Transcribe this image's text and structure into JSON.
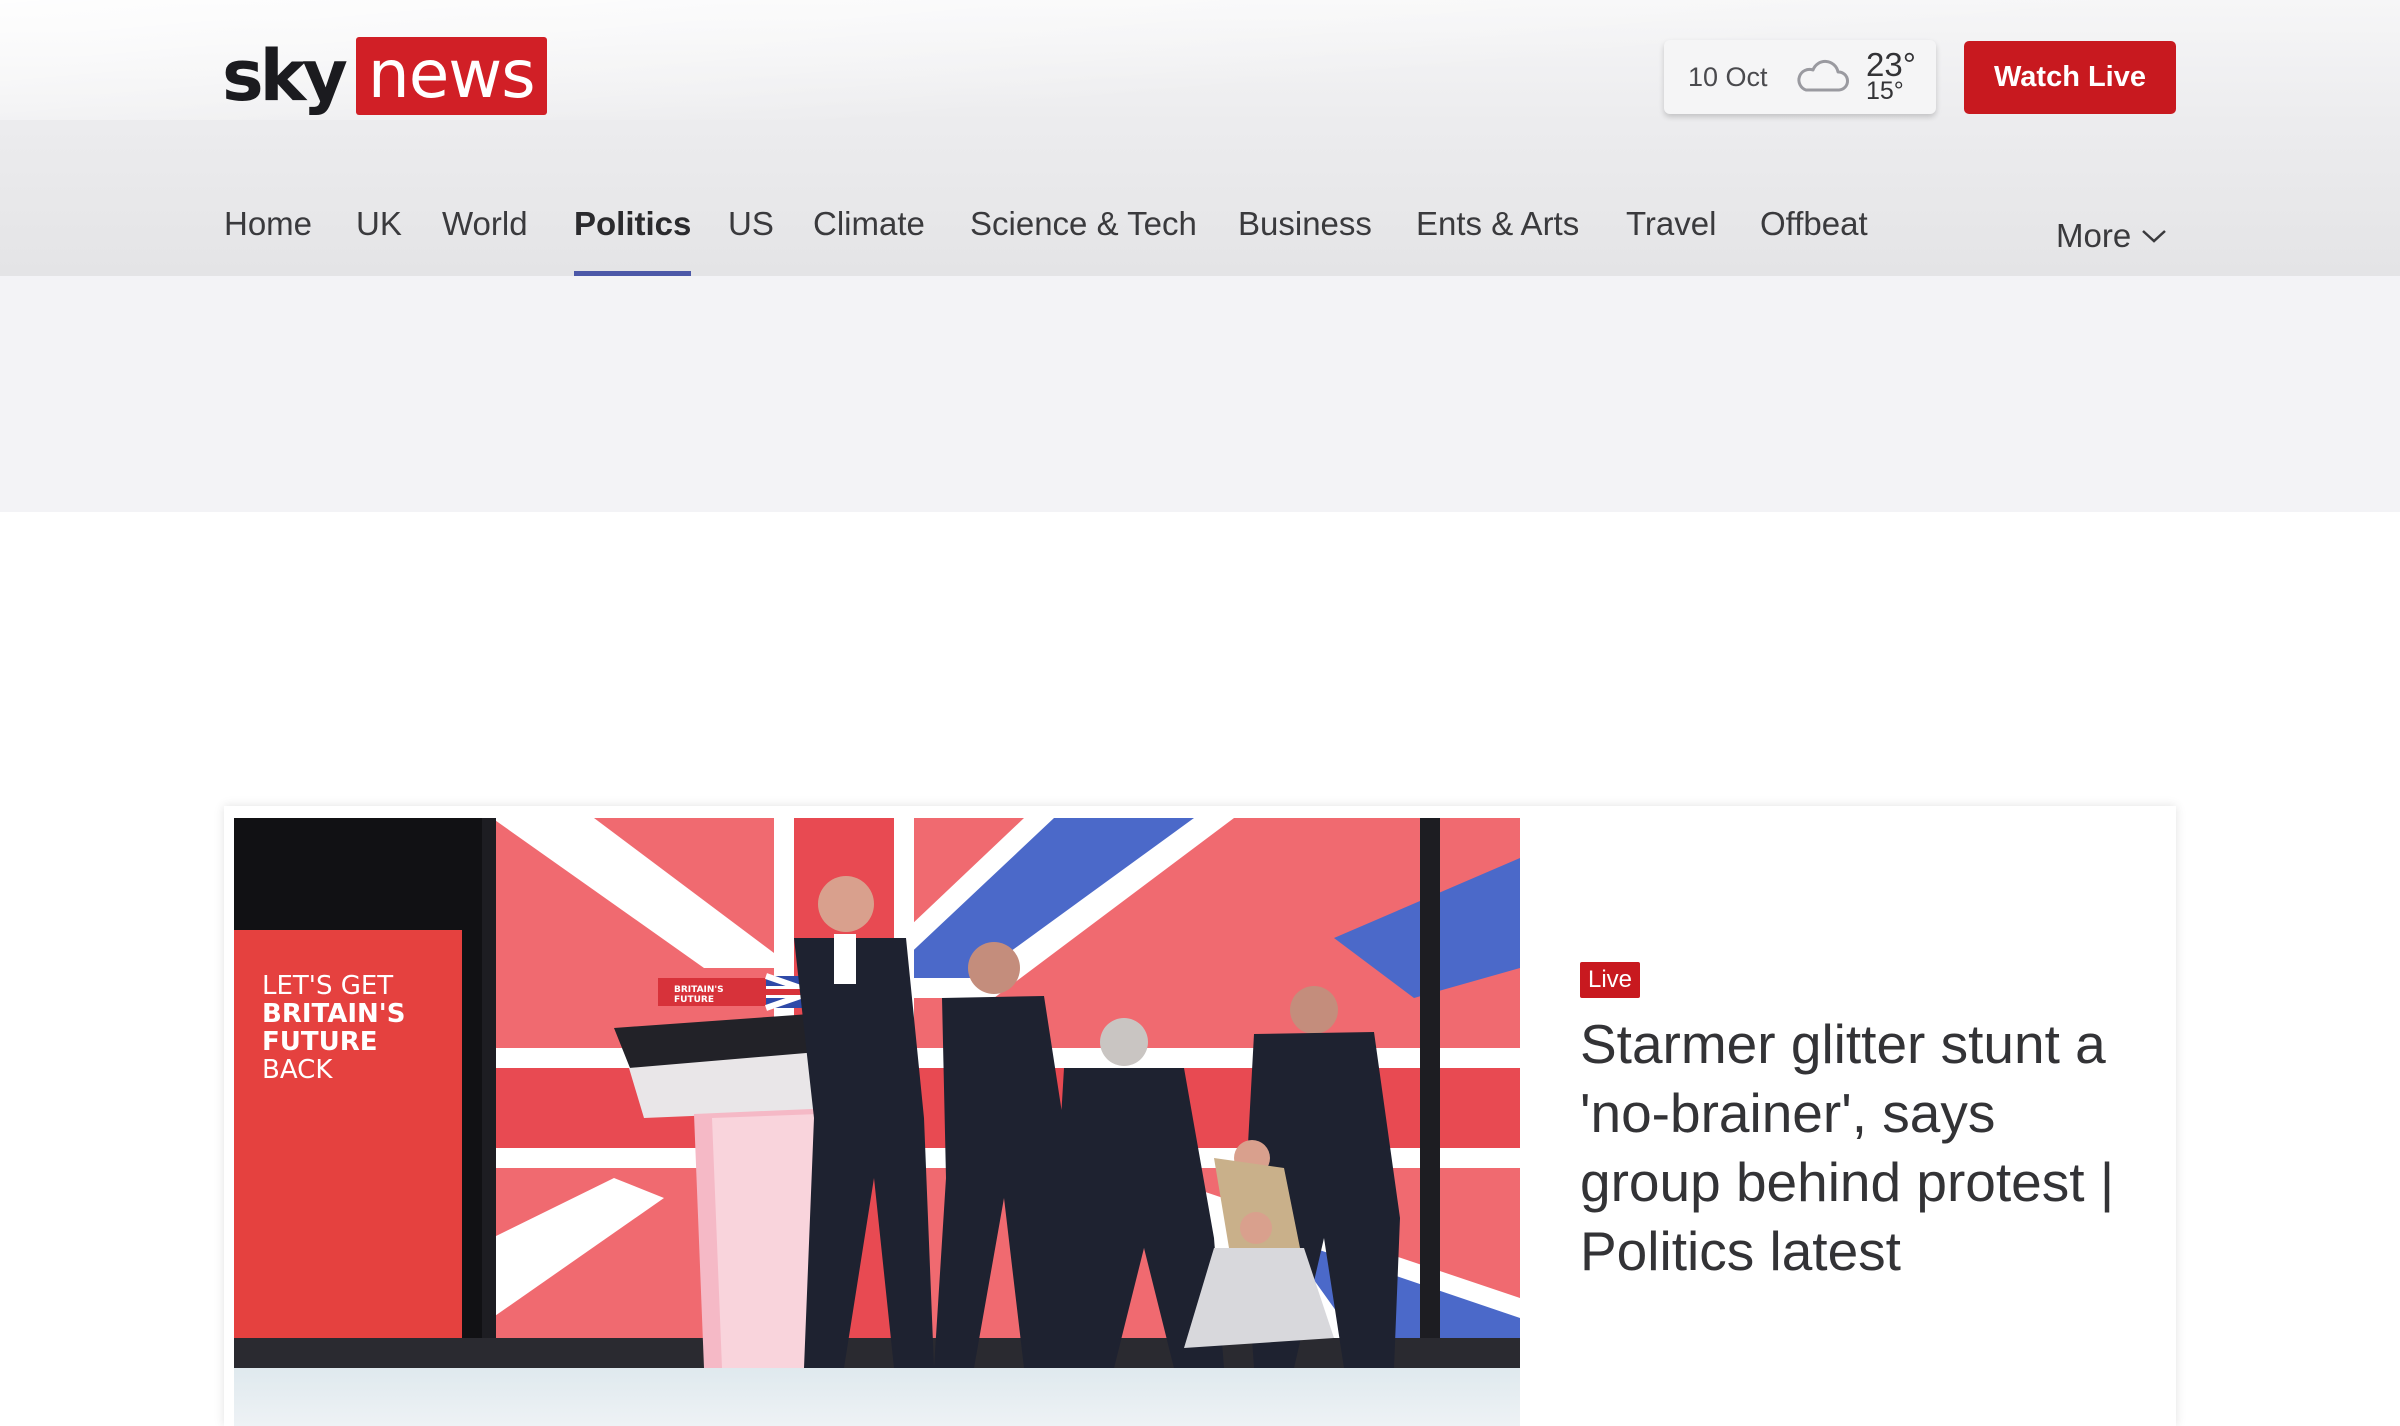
{
  "brand": {
    "logo_sky": "sky",
    "logo_news": "news",
    "accent_color": "#d11f26"
  },
  "weather": {
    "date": "10 Oct",
    "high": "23°",
    "low": "15°",
    "icon": "cloud-icon"
  },
  "header": {
    "watch_live_label": "Watch Live"
  },
  "nav": {
    "active": "Politics",
    "items": [
      {
        "label": "Home"
      },
      {
        "label": "UK"
      },
      {
        "label": "World"
      },
      {
        "label": "Politics"
      },
      {
        "label": "US"
      },
      {
        "label": "Climate"
      },
      {
        "label": "Science & Tech"
      },
      {
        "label": "Business"
      },
      {
        "label": "Ents & Arts"
      },
      {
        "label": "Travel"
      },
      {
        "label": "Offbeat"
      }
    ],
    "more_label": "More",
    "active_underline_color": "#4c58a8"
  },
  "hero": {
    "badge": "Live",
    "headline": "Starmer glitter stunt a 'no-brainer', says group behind protest | Politics latest",
    "image": {
      "screen_text": "LET'S GET BRITAIN'S FUTURE BACK",
      "podium_text": "BRITAIN'S FUTURE"
    }
  }
}
